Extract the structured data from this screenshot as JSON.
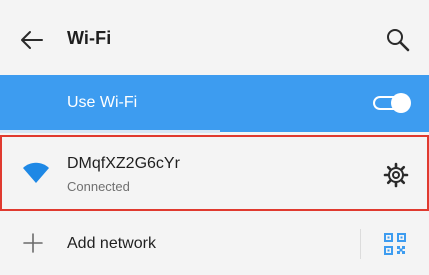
{
  "header": {
    "title": "Wi-Fi",
    "back_icon": "arrow-left-icon",
    "search_icon": "search-icon"
  },
  "toggle": {
    "label": "Use Wi-Fi",
    "state": "on",
    "background_color": "#3d9cf0"
  },
  "networks": [
    {
      "name": "DMqfXZ2G6cYr",
      "status": "Connected",
      "icon": "wifi-icon",
      "action_icon": "gear-icon",
      "icon_color": "#1e88e5",
      "highlight_color": "#e03a2f"
    }
  ],
  "add_network": {
    "label": "Add network",
    "icon": "plus-icon",
    "qr_icon": "qr-code-icon",
    "qr_color": "#3d9cf0"
  }
}
